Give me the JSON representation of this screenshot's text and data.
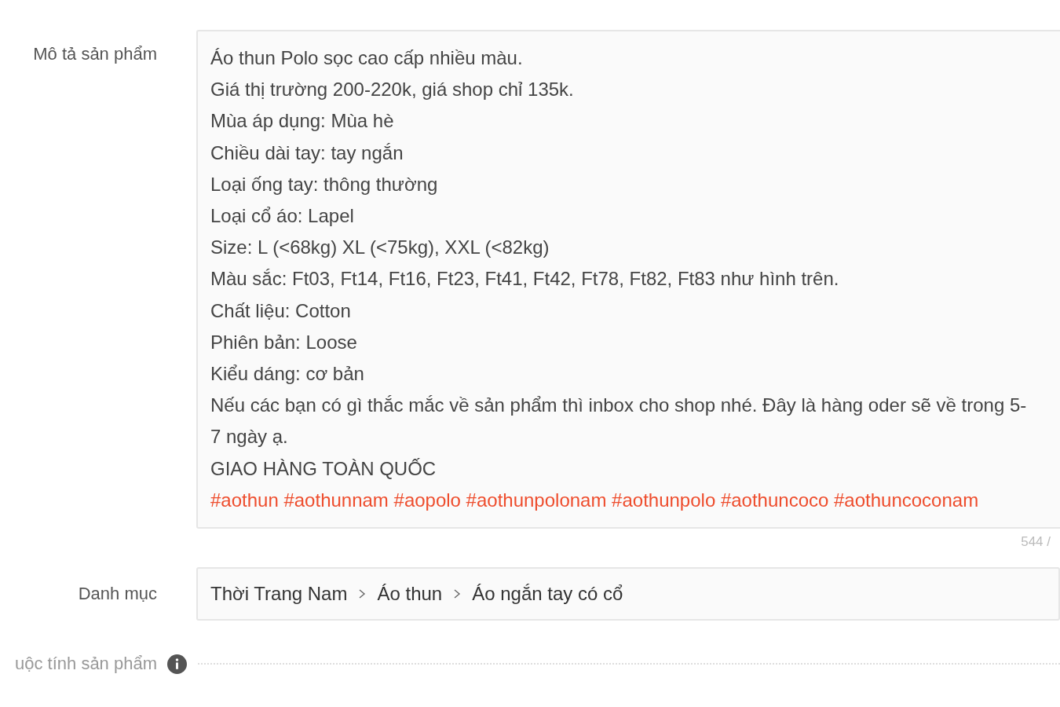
{
  "description": {
    "label": "Mô tả sản phẩm",
    "lines": [
      {
        "kind": "text",
        "text": "Áo thun Polo sọc cao cấp nhiều màu."
      },
      {
        "kind": "text",
        "text": "Giá thị trường 200-220k, giá shop chỉ 135k."
      },
      {
        "kind": "text",
        "text": "Mùa áp dụng: Mùa hè"
      },
      {
        "kind": "text",
        "text": "Chiều dài tay: tay ngắn"
      },
      {
        "kind": "text",
        "text": "Loại ống tay: thông thường"
      },
      {
        "kind": "text",
        "text": "Loại cổ áo: Lapel"
      },
      {
        "kind": "text",
        "text": "Size: L (<68kg) XL (<75kg), XXL (<82kg)"
      },
      {
        "kind": "text",
        "text": "Màu sắc: Ft03, Ft14, Ft16, Ft23, Ft41, Ft42, Ft78, Ft82, Ft83 như hình trên."
      },
      {
        "kind": "text",
        "text": "Chất liệu: Cotton"
      },
      {
        "kind": "text",
        "text": "Phiên bản: Loose"
      },
      {
        "kind": "text",
        "text": "Kiểu dáng: cơ bản"
      },
      {
        "kind": "text",
        "text": "Nếu các bạn có gì thắc mắc về sản phẩm thì inbox cho shop nhé. Đây là hàng oder sẽ về trong 5-7 ngày ạ."
      },
      {
        "kind": "text",
        "text": "GIAO HÀNG TOÀN QUỐC"
      },
      {
        "kind": "hashtags",
        "text": "#aothun #aothunnam #aopolo #aothunpolonam #aothunpolo #aothuncoco #aothuncoconam"
      }
    ],
    "counter": "544 /"
  },
  "category": {
    "label": "Danh mục",
    "path": [
      "Thời Trang Nam",
      "Áo thun",
      "Áo ngắn tay có cổ"
    ]
  },
  "attributes": {
    "label": "uộc tính sản phẩm"
  }
}
